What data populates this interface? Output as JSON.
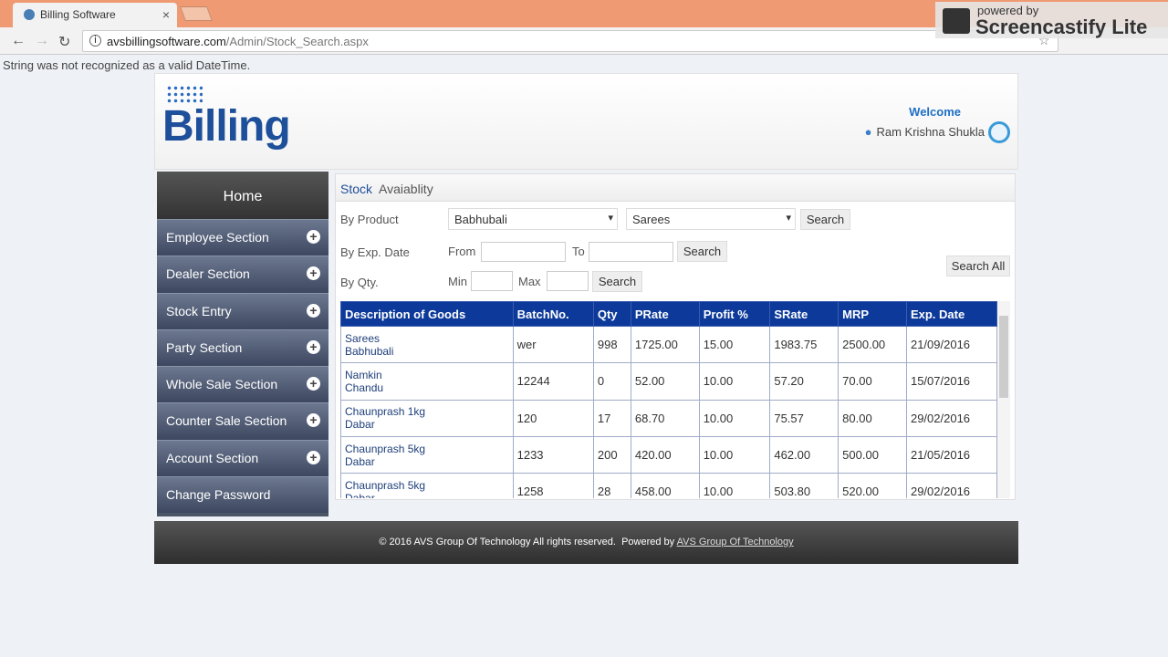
{
  "browser": {
    "tab_title": "Billing Software",
    "url_domain": "avsbillingsoftware.com",
    "url_path": "/Admin/Stock_Search.aspx"
  },
  "watermark": {
    "line1": "powered by",
    "line2": "Screencastify Lite"
  },
  "error_message": "String was not recognized as a valid DateTime.",
  "header": {
    "logo": "Billing",
    "welcome": "Welcome",
    "user_name": "Ram Krishna Shukla"
  },
  "sidebar": {
    "home": "Home",
    "items": [
      {
        "label": "Employee Section",
        "expandable": true
      },
      {
        "label": "Dealer Section",
        "expandable": true
      },
      {
        "label": "Stock Entry",
        "expandable": true
      },
      {
        "label": "Party Section",
        "expandable": true
      },
      {
        "label": "Whole Sale Section",
        "expandable": true
      },
      {
        "label": "Counter Sale Section",
        "expandable": true
      },
      {
        "label": "Account Section",
        "expandable": true
      },
      {
        "label": "Change Password",
        "expandable": false
      }
    ]
  },
  "panel": {
    "title_1": "Stock",
    "title_2": "Avaiablity",
    "by_product": "By Product",
    "product_value": "Babhubali",
    "category_value": "Sarees",
    "search": "Search",
    "by_exp_date": "By Exp. Date",
    "from": "From",
    "to": "To",
    "by_qty": "By Qty.",
    "min": "Min",
    "max": "Max",
    "search_all": "Search All"
  },
  "table": {
    "headers": [
      "Description of Goods",
      "BatchNo.",
      "Qty",
      "PRate",
      "Profit %",
      "SRate",
      "MRP",
      "Exp. Date"
    ],
    "rows": [
      {
        "name": "Sarees",
        "brand": "Babhubali",
        "batch": "wer",
        "qty": "998",
        "prate": "1725.00",
        "profit": "15.00",
        "srate": "1983.75",
        "mrp": "2500.00",
        "exp": "21/09/2016"
      },
      {
        "name": "Namkin",
        "brand": "Chandu",
        "batch": "12244",
        "qty": "0",
        "prate": "52.00",
        "profit": "10.00",
        "srate": "57.20",
        "mrp": "70.00",
        "exp": "15/07/2016"
      },
      {
        "name": "Chaunprash 1kg",
        "brand": "Dabar",
        "batch": "120",
        "qty": "17",
        "prate": "68.70",
        "profit": "10.00",
        "srate": "75.57",
        "mrp": "80.00",
        "exp": "29/02/2016"
      },
      {
        "name": "Chaunprash 5kg",
        "brand": "Dabar",
        "batch": "1233",
        "qty": "200",
        "prate": "420.00",
        "profit": "10.00",
        "srate": "462.00",
        "mrp": "500.00",
        "exp": "21/05/2016"
      },
      {
        "name": "Chaunprash 5kg",
        "brand": "Dabar",
        "batch": "1258",
        "qty": "28",
        "prate": "458.00",
        "profit": "10.00",
        "srate": "503.80",
        "mrp": "520.00",
        "exp": "29/02/2016"
      }
    ]
  },
  "footer": {
    "text": "© 2016 AVS Group Of Technology All rights reserved.  Powered by ",
    "link": "AVS Group Of Technology"
  }
}
